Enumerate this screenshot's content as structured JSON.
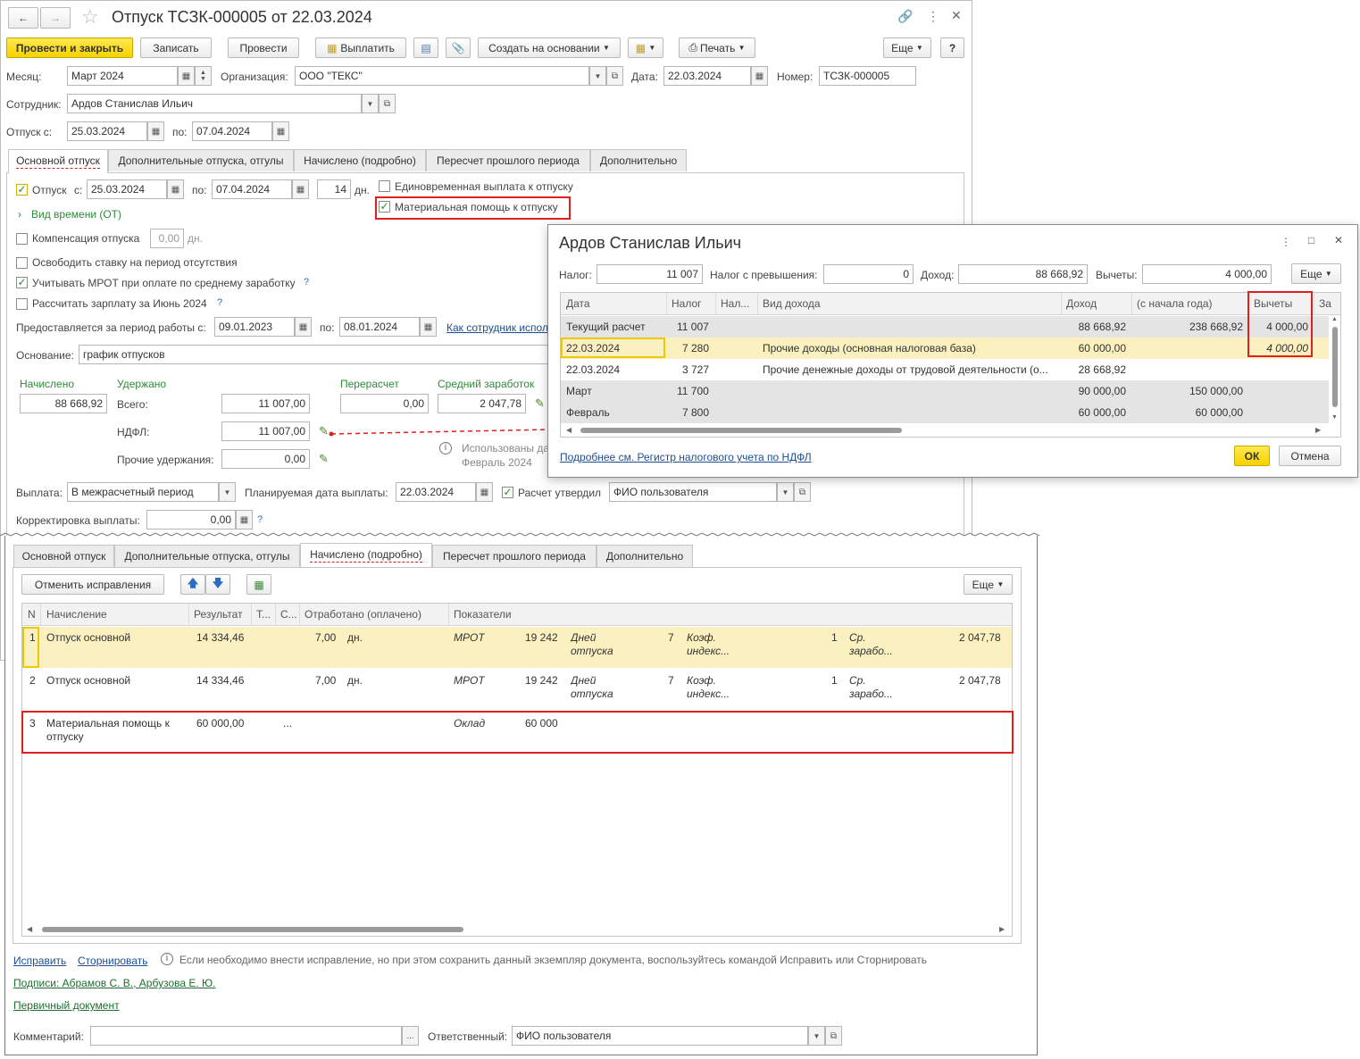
{
  "main": {
    "title": "Отпуск ТСЗК-000005 от 22.03.2024",
    "toolbar": {
      "post_close": "Провести и закрыть",
      "save": "Записать",
      "post": "Провести",
      "pay": "Выплатить",
      "create_based": "Создать на основании",
      "print": "Печать",
      "more": "Еще",
      "help": "?"
    },
    "month_label": "Месяц:",
    "month": "Март 2024",
    "org_label": "Организация:",
    "org": "ООО \"ТЕКС\"",
    "date_label": "Дата:",
    "date": "22.03.2024",
    "number_label": "Номер:",
    "number": "ТСЗК-000005",
    "employee_label": "Сотрудник:",
    "employee": "Ардов Станислав Ильич",
    "leave_from_label": "Отпуск с:",
    "leave_from": "25.03.2024",
    "to_label": "по:",
    "leave_to": "07.04.2024",
    "tabs": [
      "Основной отпуск",
      "Дополнительные отпуска, отгулы",
      "Начислено (подробно)",
      "Пересчет прошлого периода",
      "Дополнительно"
    ],
    "vac_check": "Отпуск",
    "vac_from_label": "с:",
    "vac_from": "25.03.2024",
    "vac_to_label": "по:",
    "vac_to": "07.04.2024",
    "days": "14",
    "days_unit": "дн.",
    "one_time": "Единовременная выплата к отпуску",
    "mat_help": "Материальная помощь к отпуску",
    "time_kind": "Вид времени (ОТ)",
    "compensation": "Компенсация отпуска",
    "comp_value": "0,00",
    "comp_unit": "дн.",
    "release_rate": "Освободить ставку на период отсутствия",
    "mrot": "Учитывать МРОТ при оплате по среднему заработку",
    "calc_salary": "Рассчитать зарплату за Июнь 2024",
    "period_label": "Предоставляется за период работы с:",
    "period_from": "09.01.2023",
    "period_to_label": "по:",
    "period_to": "08.01.2024",
    "employee_link": "Как сотрудник испол",
    "basis_label": "Основание:",
    "basis": "график отпусков",
    "accrued_label": "Начислено",
    "accrued": "88 668,92",
    "withheld_label": "Удержано",
    "total_label": "Всего:",
    "total": "11 007,00",
    "ndfl_label": "НДФЛ:",
    "ndfl": "11 007,00",
    "other_label": "Прочие удержания:",
    "other": "0,00",
    "recalc_label": "Перерасчет",
    "recalc": "0,00",
    "avg_label": "Средний заработок",
    "avg": "2 047,78",
    "used_note": "Использованы да",
    "used_note2": "Февраль 2024",
    "payout_label": "Выплата:",
    "payout": "В межрасчетный период",
    "planned_label": "Планируемая дата выплаты:",
    "planned": "22.03.2024",
    "approved_label": "Расчет утвердил",
    "approved": "ФИО пользователя",
    "correction_label": "Корректировка выплаты:",
    "correction": "0,00"
  },
  "popup": {
    "title": "Ардов Станислав Ильич",
    "tax_label": "Налог:",
    "tax": "11 007",
    "tax_over_label": "Налог с превышения:",
    "tax_over": "0",
    "income_label": "Доход:",
    "income": "88 668,92",
    "deductions_label": "Вычеты:",
    "deductions": "4 000,00",
    "more": "Еще",
    "columns": [
      "Дата",
      "Налог",
      "Нал...",
      "Вид дохода",
      "Доход",
      "(с начала года)",
      "Вычеты",
      "За"
    ],
    "rows": [
      {
        "date": "Текущий расчет",
        "tax": "11 007",
        "kind": "",
        "income": "88 668,92",
        "ytd": "238 668,92",
        "ded": "4 000,00"
      },
      {
        "date": "22.03.2024",
        "tax": "7 280",
        "kind": "Прочие доходы (основная налоговая база)",
        "income": "60 000,00",
        "ytd": "",
        "ded": "4 000,00"
      },
      {
        "date": "22.03.2024",
        "tax": "3 727",
        "kind": "Прочие денежные доходы от трудовой деятельности (о...",
        "income": "28 668,92",
        "ytd": "",
        "ded": ""
      },
      {
        "date": "Март",
        "tax": "11 700",
        "kind": "",
        "income": "90 000,00",
        "ytd": "150 000,00",
        "ded": ""
      },
      {
        "date": "Февраль",
        "tax": "7 800",
        "kind": "",
        "income": "60 000,00",
        "ytd": "60 000,00",
        "ded": ""
      }
    ],
    "register_link": "Подробнее см. Регистр налогового учета по НДФЛ",
    "ok": "ОК",
    "cancel": "Отмена"
  },
  "lower": {
    "tabs": [
      "Основной отпуск",
      "Дополнительные отпуска, отгулы",
      "Начислено (подробно)",
      "Пересчет прошлого периода",
      "Дополнительно"
    ],
    "cancel_fix": "Отменить исправления",
    "more": "Еще",
    "columns": [
      "N",
      "Начисление",
      "Результат",
      "Т...",
      "С...",
      "Отработано (оплачено)",
      "Показатели"
    ],
    "rows": [
      {
        "n": "1",
        "name": "Отпуск основной",
        "result": "14 334,46",
        "worked": "7,00",
        "unit": "дн.",
        "p1": "МРОТ",
        "v1": "19 242",
        "p2a": "Дней",
        "p2b": "отпуска",
        "v2": "7",
        "p3a": "Коэф.",
        "p3b": "индекс...",
        "v3": "1",
        "p4a": "Ср.",
        "p4b": "зарабо...",
        "v4": "2 047,78"
      },
      {
        "n": "2",
        "name": "Отпуск основной",
        "result": "14 334,46",
        "worked": "7,00",
        "unit": "дн.",
        "p1": "МРОТ",
        "v1": "19 242",
        "p2a": "Дней",
        "p2b": "отпуска",
        "v2": "7",
        "p3a": "Коэф.",
        "p3b": "индекс...",
        "v3": "1",
        "p4a": "Ср.",
        "p4b": "зарабо...",
        "v4": "2 047,78"
      },
      {
        "n": "3",
        "name": "Материальная помощь к",
        "name2": "отпуску",
        "result": "60 000,00",
        "dots": "...",
        "p1": "Оклад",
        "v1": "60 000"
      }
    ],
    "fix": "Исправить",
    "storno": "Сторнировать",
    "fix_note": "Если необходимо внести исправление, но при этом сохранить данный экземпляр документа, воспользуйтесь командой Исправить или Сторнировать",
    "signatures": "Подписи: Абрамов С. В., Арбузова Е. Ю.",
    "primary_doc": "Первичный документ",
    "comment_label": "Комментарий:",
    "comment": "",
    "responsible_label": "Ответственный:",
    "responsible": "ФИО пользователя"
  }
}
